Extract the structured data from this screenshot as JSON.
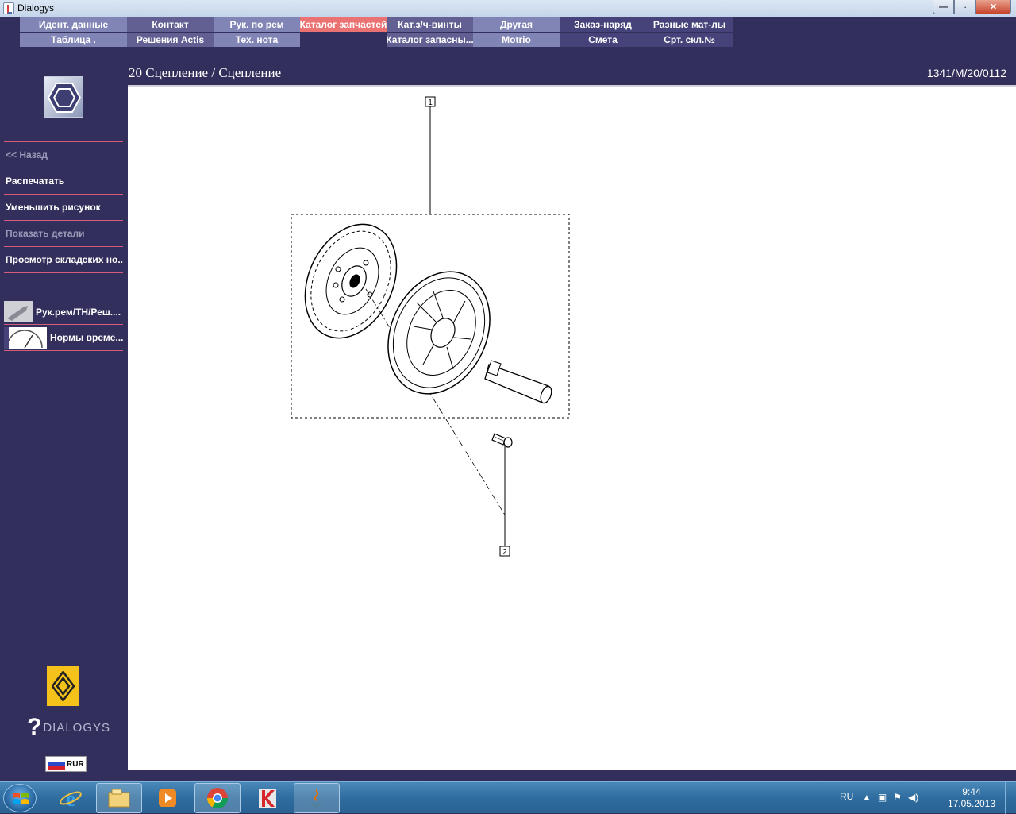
{
  "window": {
    "title": "Dialogys"
  },
  "menu": {
    "row1": [
      {
        "label": "Идент. данные",
        "style": "c1"
      },
      {
        "label": "Контакт",
        "style": "c2"
      },
      {
        "label": "Рук. по рем",
        "style": "c1"
      },
      {
        "label": "Каталог запчастей",
        "style": "c3"
      },
      {
        "label": "Кат.з/ч-винты",
        "style": "c2"
      },
      {
        "label": "Другая",
        "style": "c1"
      },
      {
        "label": "Заказ-наряд",
        "style": "c4"
      },
      {
        "label": "Разные мат-лы",
        "style": "c4"
      }
    ],
    "row2": [
      {
        "label": "Таблица .",
        "style": "c1"
      },
      {
        "label": "Решения Actis",
        "style": "c2"
      },
      {
        "label": "Тех. нота",
        "style": "c1"
      },
      {
        "label": "",
        "style": "c0"
      },
      {
        "label": "Каталог запасны...",
        "style": "c2"
      },
      {
        "label": "Motrio",
        "style": "c1"
      },
      {
        "label": "Смета",
        "style": "c4"
      },
      {
        "label": "Срт. скл.№",
        "style": "c4"
      }
    ]
  },
  "sidebar": {
    "back": "<< Назад",
    "print": "Распечатать",
    "zoom_out": "Уменьшить рисунок",
    "show_details": "Показать детали",
    "stock_view": "Просмотр складских но...",
    "tool1": "Рук.рем/ТН/Реш....",
    "tool2": "Нормы време...",
    "brand": "DIALOGYS",
    "currency": "RUR"
  },
  "content": {
    "title": "20 Сцепление / Сцепление",
    "reference": "1341/M/20/0112",
    "callouts": [
      "1",
      "2"
    ]
  },
  "taskbar": {
    "lang": "RU",
    "time": "9:44",
    "date": "17.05.2013"
  },
  "colors": {
    "background": "#332f5c",
    "menu_active": "#eb7272",
    "separator": "#d65a7a"
  }
}
